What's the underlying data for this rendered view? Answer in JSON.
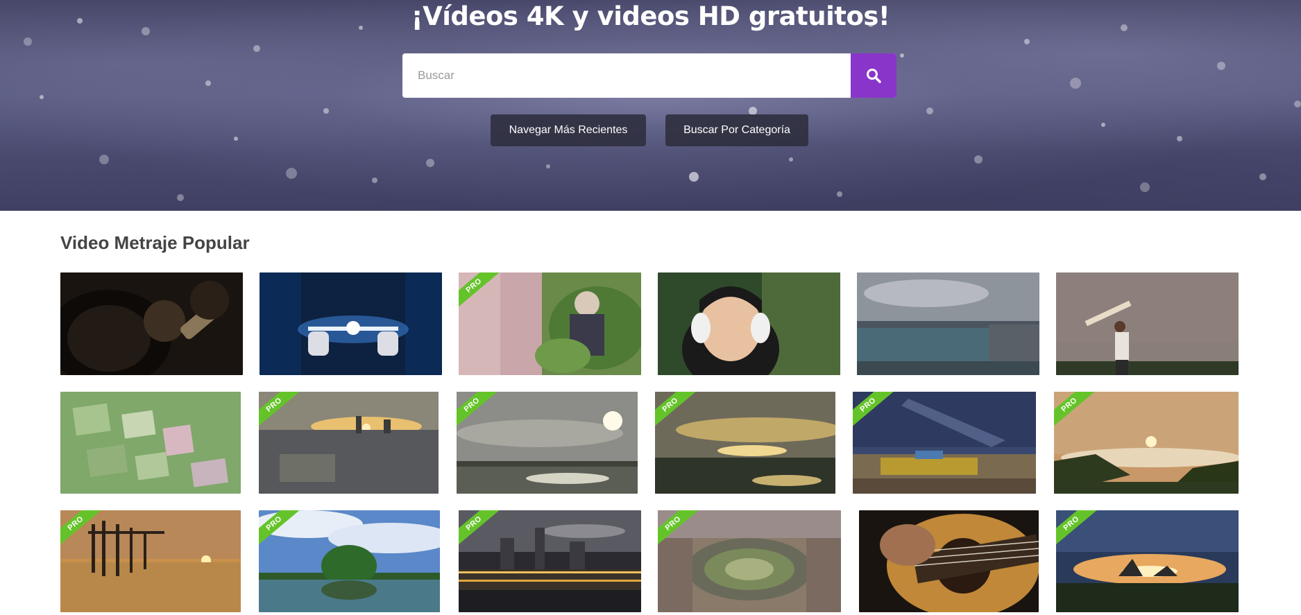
{
  "hero": {
    "title": "¡Vídeos 4K y videos HD gratuitos!",
    "search_placeholder": "Buscar",
    "search_icon": "search-icon",
    "buttons": {
      "recent": "Navegar Más Recientes",
      "category": "Buscar Por Categoría"
    }
  },
  "section": {
    "title": "Video Metraje Popular"
  },
  "badge_text": "PRO",
  "colors": {
    "accent": "#8a35c9",
    "pro_badge": "#65c32a",
    "button_bg": "#2d2d3e"
  },
  "videos": [
    {
      "subject": "vinyl record player",
      "pro": false
    },
    {
      "subject": "glowing tablet in hands",
      "pro": false
    },
    {
      "subject": "elderly woman in garden",
      "pro": true
    },
    {
      "subject": "child with headphones",
      "pro": false
    },
    {
      "subject": "coastal city bay",
      "pro": false
    },
    {
      "subject": "boy with toy airplane",
      "pro": false
    },
    {
      "subject": "aerial rice fields",
      "pro": false
    },
    {
      "subject": "city skyline sunset",
      "pro": true
    },
    {
      "subject": "sun over wetland",
      "pro": true
    },
    {
      "subject": "clouds over lake",
      "pro": true
    },
    {
      "subject": "boat under milky way",
      "pro": true
    },
    {
      "subject": "sunrise over misty hills",
      "pro": true
    },
    {
      "subject": "pier at sunset",
      "pro": true
    },
    {
      "subject": "tree island in lake",
      "pro": true
    },
    {
      "subject": "night city skyline",
      "pro": true
    },
    {
      "subject": "roundabout aerial view",
      "pro": true
    },
    {
      "subject": "playing acoustic guitar",
      "pro": false
    },
    {
      "subject": "sunset over islands",
      "pro": true
    }
  ]
}
